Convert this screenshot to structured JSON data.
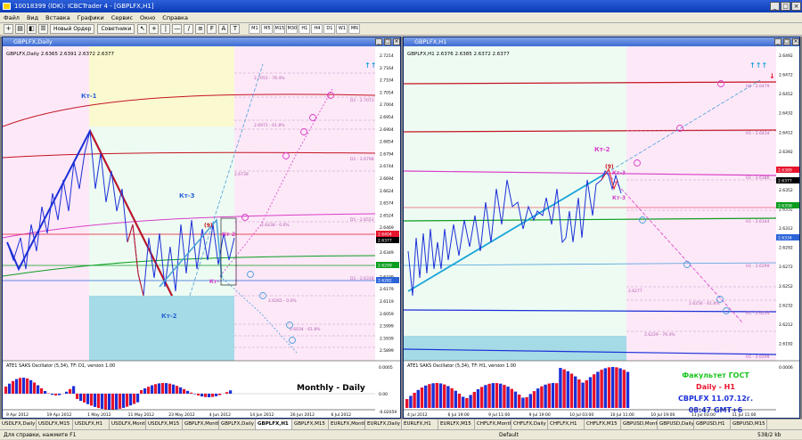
{
  "window": {
    "title": "10018399 (lDK): ICBCTrader 4 - [GBPLFX,H1]",
    "minimize": "_",
    "maximize": "□",
    "close": "×"
  },
  "menu": [
    "Файл",
    "Вид",
    "Вставка",
    "Графики",
    "Сервис",
    "Окно",
    "Справка"
  ],
  "toolbar": {
    "new_order": "Новый Ордер",
    "advisors": "Советники",
    "timeframes": [
      "M1",
      "M5",
      "M15",
      "M30",
      "H1",
      "H4",
      "D1",
      "W1",
      "MN"
    ]
  },
  "left_chart": {
    "window_title": "GBPLFX,Daily",
    "header": "GBPLFX,Daily  2.6365 2.6391 2.6372 2.6377",
    "price_axis": [
      "2.7214",
      "2.7164",
      "2.7104",
      "2.7054",
      "2.7004",
      "2.6954",
      "2.6904",
      "2.6854",
      "2.6794",
      "2.6744",
      "2.6694",
      "2.6624",
      "2.6574",
      "2.6524",
      "2.6469",
      "2.6409",
      "2.6349",
      "2.6299",
      "2.6239",
      "2.6179",
      "2.6119",
      "2.6059",
      "2.5999",
      "2.5939",
      "2.5899"
    ],
    "date_axis": [
      "9 Apr 2012",
      "19 Apr 2012",
      "1 May 2012",
      "11 May 2012",
      "23 May 2012",
      "4 Jun 2012",
      "14 Jun 2012",
      "26 Jun 2012",
      "6 Jul 2012"
    ],
    "labels": {
      "kt1": "Кт-1",
      "kt2": "Кт-2",
      "kt3": "Кт-3",
      "kt2b": "Кт-2",
      "ktz": "Кт-",
      "n9": "(9)"
    },
    "levels": [
      "D1 - 2.7073",
      "D1 - 2.6798",
      "D1 - 2.6553",
      "D1 - 2.6318",
      "2.7051 - 76.4%",
      "2.6971 - 61.8%",
      "2.6739",
      "2.6438 - 0.0%",
      "2.6265 - 0.0%",
      "2.6034 - 61.8%"
    ],
    "oscillator_header": "ATE1 SAKS Oscillator (5,34), TF: D1, version 1.00",
    "oscillator_axis": [
      "0.0005",
      "0.00",
      "-0.02059"
    ],
    "price_tags": [
      {
        "value": "2.6404",
        "color": "#e8132c"
      },
      {
        "value": "2.6377",
        "color": "#000000"
      },
      {
        "value": "2.6299",
        "color": "#0a9d1e"
      },
      {
        "value": "2.6282",
        "color": "#2c64d8"
      }
    ],
    "caption": "Monthly - Daily"
  },
  "right_chart": {
    "window_title": "GBPLFX,H1",
    "header": "GBPLFX,H1  2.6376 2.6385 2.6372 2.6377",
    "price_axis": [
      "2.6492",
      "2.6472",
      "2.6452",
      "2.6432",
      "2.6412",
      "2.6392",
      "2.6372",
      "2.6352",
      "2.6332",
      "2.6312",
      "2.6292",
      "2.6272",
      "2.6252",
      "2.6232",
      "2.6212",
      "2.6192"
    ],
    "date_axis": [
      "4 Jul 2012",
      "6 Jul 19:00",
      "9 Jul 11:00",
      "9 Jul 19:00",
      "10 Jul 03:00",
      "10 Jul 11:00",
      "10 Jul 19:00",
      "11 Jul 03:00",
      "11 Jul 11:00"
    ],
    "labels": {
      "kt2": "Кт-2",
      "kt3": "Кт-3",
      "ktz": "Кт-3",
      "n9": "(9)"
    },
    "levels": [
      "H1 - 2.6479",
      "H1 - 2.6434",
      "H1 - 2.6386",
      "H1 - 2.6344",
      "H1 - 2.6299",
      "H1 - 2.6254",
      "H1 - 2.6209",
      "2.6277",
      "2.6256 - 61.8%",
      "2.6229 - 76.4%"
    ],
    "oscillator_header": "ATE1 SAKS Oscillator (5,34), TF: H1, version 1.00",
    "oscillator_axis": [
      "0.0006"
    ],
    "price_tags": [
      {
        "value": "2.6389",
        "color": "#e8132c"
      },
      {
        "value": "2.6377",
        "color": "#000000"
      },
      {
        "value": "2.6358",
        "color": "#0a9d1e"
      },
      {
        "value": "2.6334",
        "color": "#2c64d8"
      }
    ],
    "caption_lines": [
      {
        "text": "Факультет ГОСТ",
        "color": "#19c41d"
      },
      {
        "text": "Daily - H1",
        "color": "#e8132c"
      },
      {
        "text": "CBPLFX 11.07.12г.",
        "color": "#1b2fd8"
      },
      {
        "text": "08:47 GMT+6",
        "color": "#1b2fd8"
      }
    ]
  },
  "tabs": [
    "USDLFX,Daily",
    "USDLFX,M15",
    "USDLFX,H1",
    "USDLFX,Monthly",
    "USDLFX,M15",
    "GBPLFX,Monthly",
    "GBPLFX,Daily",
    "GBPLFX,H1",
    "GBPLFX,M15",
    "EURLFX,Monthly",
    "EURLFX,Daily",
    "EURLFX,H1",
    "EURLFX,M15",
    "CHFLFX,Monthly",
    "CHFLFX,Daily",
    "CHFLFX,H1",
    "CHFLFX,M15",
    "GBPUSD,Monthly",
    "GBPUSD,Daily",
    "GBPUSD,H1",
    "GBPUSD,M15"
  ],
  "active_tab": 7,
  "status": {
    "help": "Для справки, нажмите F1",
    "profile": "Default",
    "traffic": "538/2 kb"
  }
}
